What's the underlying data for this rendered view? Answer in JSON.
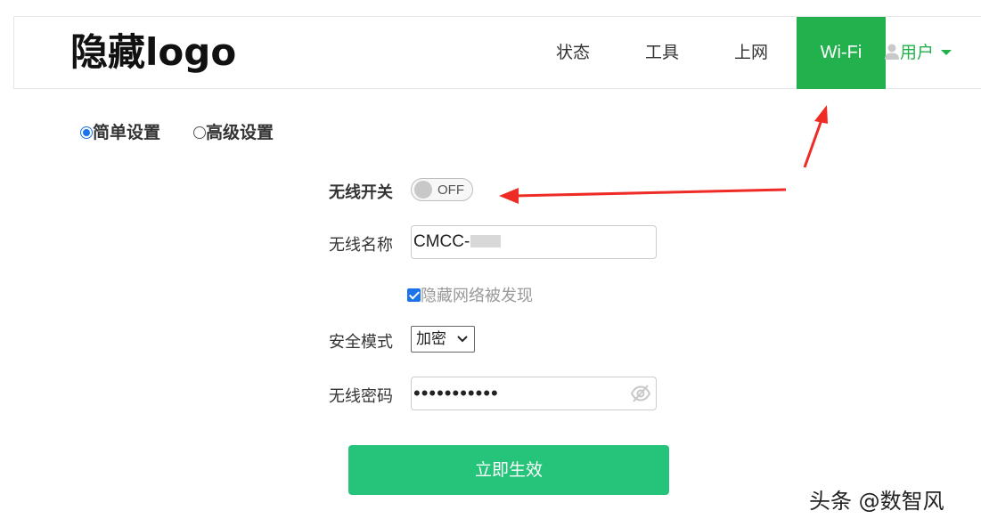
{
  "header": {
    "logo_text": "隐藏logo",
    "nav": {
      "status": "状态",
      "tools": "工具",
      "internet": "上网",
      "wifi": "Wi-Fi"
    },
    "user_label": "用户",
    "active_color": "#22b14c"
  },
  "mode": {
    "simple_label": "简单设置",
    "advanced_label": "高级设置",
    "selected": "简单设置"
  },
  "form": {
    "switch_label": "无线开关",
    "switch_state": "OFF",
    "ssid_label": "无线名称",
    "ssid_value": "CMCC-",
    "hide_network_label": "隐藏网络被发现",
    "hide_network_checked": true,
    "security_label": "安全模式",
    "security_value": "加密",
    "password_label": "无线密码",
    "password_value": "•••••••••••"
  },
  "submit_label": "立即生效",
  "submit_color": "#26c47a",
  "watermark": "头条 @数智风",
  "icons": {
    "user": "user-icon",
    "caret": "caret-down-icon",
    "eye": "eye-slash-icon",
    "select": "chevron-down-icon"
  },
  "annotation_color": "#ee2b24"
}
